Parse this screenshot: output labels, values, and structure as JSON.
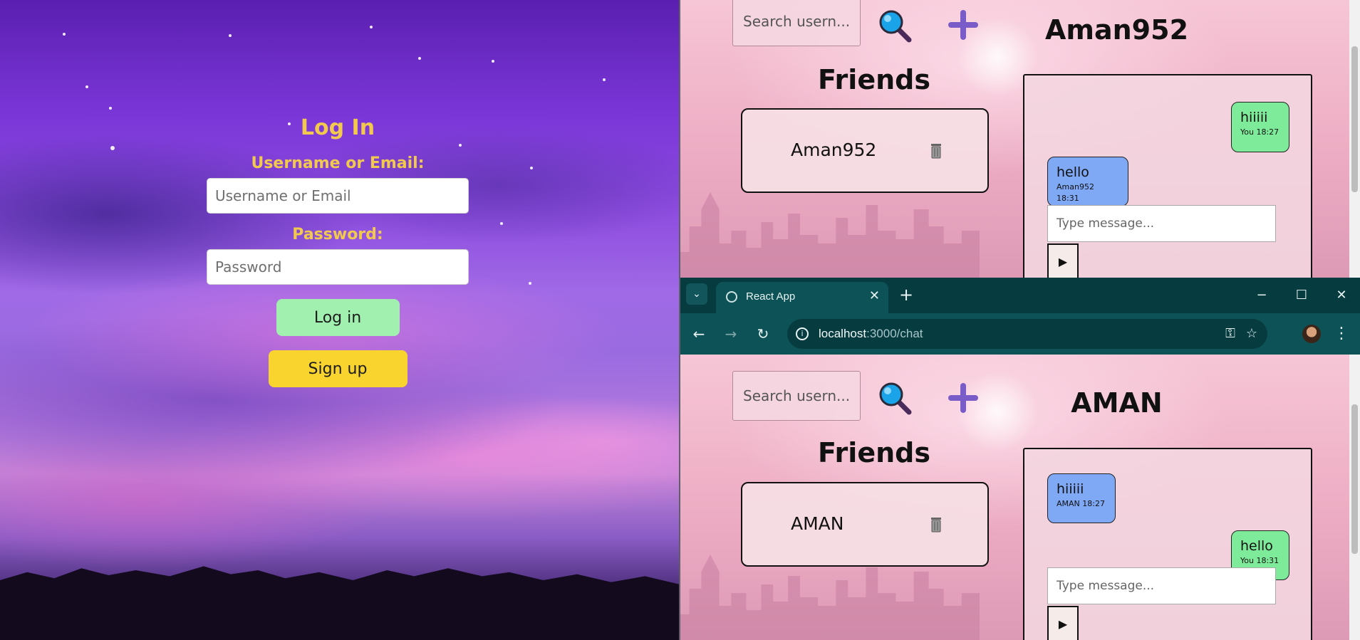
{
  "login": {
    "title": "Log In",
    "username_label": "Username or Email:",
    "username_placeholder": "Username or Email",
    "password_label": "Password:",
    "password_placeholder": "Password",
    "login_button": "Log in",
    "signup_button": "Sign up"
  },
  "top_window": {
    "search_placeholder": "Search usern...",
    "chat_title": "Aman952",
    "friends_heading": "Friends",
    "friends": [
      {
        "name": "Aman952"
      }
    ],
    "messages": [
      {
        "text": "hiiiii",
        "meta": "You 18:27",
        "side": "sent"
      },
      {
        "text": "hello",
        "meta": "Aman952 18:31",
        "side": "received"
      }
    ],
    "message_placeholder": "Type message...",
    "send_label": "▶"
  },
  "browser": {
    "tab_title": "React App",
    "url_host": "localhost",
    "url_path": ":3000/chat"
  },
  "bottom_window": {
    "search_placeholder": "Search usern...",
    "chat_title": "AMAN",
    "friends_heading": "Friends",
    "friends": [
      {
        "name": "AMAN"
      }
    ],
    "messages": [
      {
        "text": "hiiiii",
        "meta": "AMAN 18:27",
        "side": "received"
      },
      {
        "text": "hello",
        "meta": "You 18:31",
        "side": "sent"
      }
    ],
    "message_placeholder": "Type message...",
    "send_label": "▶"
  },
  "colors": {
    "login_accent": "#f2c94c",
    "login_button": "#a1f0b0",
    "signup_button": "#fad42e",
    "sent_bubble": "#7deb9a",
    "received_bubble": "#7fa8f5",
    "browser_frame": "#0d5257"
  }
}
